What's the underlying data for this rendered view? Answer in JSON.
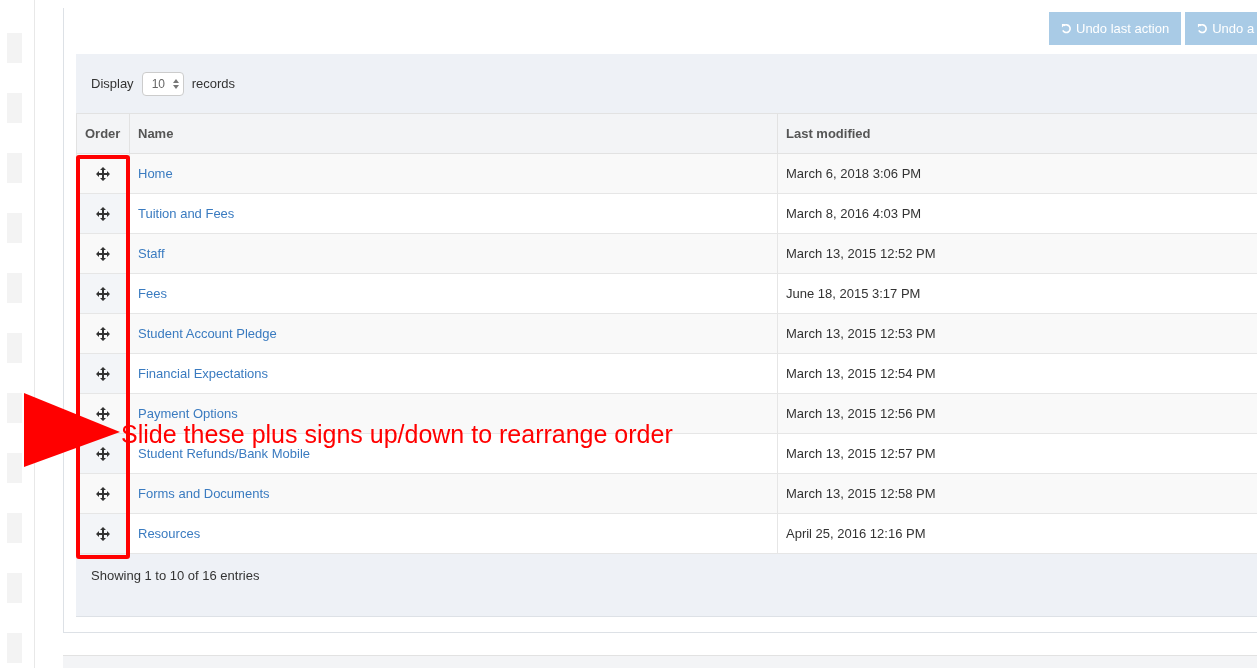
{
  "toolbar": {
    "buttons": [
      {
        "label": "Undo last action"
      },
      {
        "label": "Undo a"
      }
    ]
  },
  "display": {
    "before": "Display",
    "value": "10",
    "after": "records"
  },
  "table": {
    "columns": [
      "Order",
      "Name",
      "Last modified"
    ],
    "rows": [
      {
        "name": "Home",
        "modified": "March 6, 2018 3:06 PM"
      },
      {
        "name": "Tuition and Fees",
        "modified": "March 8, 2016 4:03 PM"
      },
      {
        "name": "Staff",
        "modified": "March 13, 2015 12:52 PM"
      },
      {
        "name": "Fees",
        "modified": "June 18, 2015 3:17 PM"
      },
      {
        "name": "Student Account Pledge",
        "modified": "March 13, 2015 12:53 PM"
      },
      {
        "name": "Financial Expectations",
        "modified": "March 13, 2015 12:54 PM"
      },
      {
        "name": "Payment Options",
        "modified": "March 13, 2015 12:56 PM"
      },
      {
        "name": "Student Refunds/Bank Mobile",
        "modified": "March 13, 2015 12:57 PM"
      },
      {
        "name": "Forms and Documents",
        "modified": "March 13, 2015 12:58 PM"
      },
      {
        "name": "Resources",
        "modified": "April 25, 2016 12:16 PM"
      }
    ]
  },
  "footer": "Showing 1 to 10 of 16 entries",
  "annotation": {
    "text": "Slide these plus signs up/down to rearrange order"
  }
}
